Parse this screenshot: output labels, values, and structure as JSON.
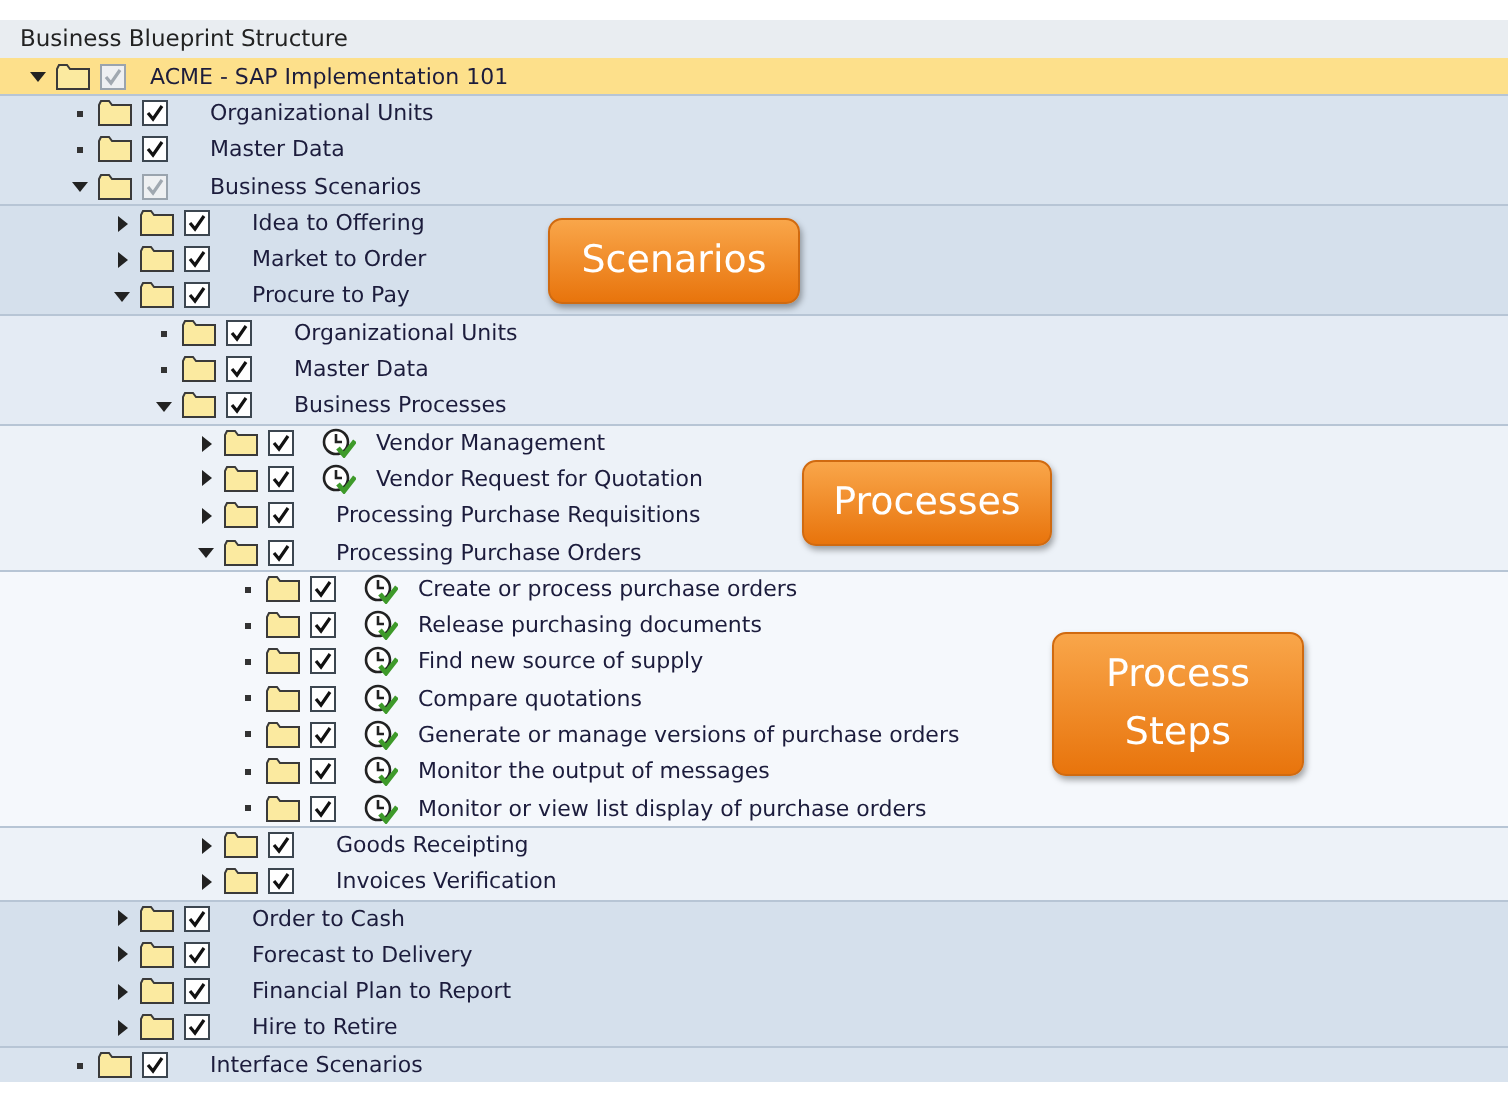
{
  "header": {
    "title": "Business Blueprint Structure"
  },
  "tree": [
    {
      "label": "ACME - SAP Implementation 101",
      "kind": "branch",
      "expanded": true,
      "selected": true,
      "checked": true,
      "disabled": true,
      "process_icon": false,
      "children": [
        {
          "label": "Organizational Units",
          "kind": "leaf",
          "selected": false,
          "checked": true,
          "disabled": false,
          "process_icon": false
        },
        {
          "label": "Master Data",
          "kind": "leaf",
          "selected": false,
          "checked": true,
          "disabled": false,
          "process_icon": false
        },
        {
          "label": "Business Scenarios",
          "kind": "branch",
          "expanded": true,
          "selected": false,
          "checked": true,
          "disabled": true,
          "process_icon": false,
          "children": [
            {
              "label": "Idea to Offering",
              "kind": "branch",
              "expanded": false,
              "selected": false,
              "checked": true,
              "disabled": false,
              "process_icon": false
            },
            {
              "label": "Market to Order",
              "kind": "branch",
              "expanded": false,
              "selected": false,
              "checked": true,
              "disabled": false,
              "process_icon": false
            },
            {
              "label": "Procure to Pay",
              "kind": "branch",
              "expanded": true,
              "selected": false,
              "checked": true,
              "disabled": false,
              "process_icon": false,
              "children": [
                {
                  "label": "Organizational Units",
                  "kind": "leaf",
                  "selected": false,
                  "checked": true,
                  "disabled": false,
                  "process_icon": false
                },
                {
                  "label": "Master Data",
                  "kind": "leaf",
                  "selected": false,
                  "checked": true,
                  "disabled": false,
                  "process_icon": false
                },
                {
                  "label": "Business Processes",
                  "kind": "branch",
                  "expanded": true,
                  "selected": false,
                  "checked": true,
                  "disabled": false,
                  "process_icon": false,
                  "children": [
                    {
                      "label": "Vendor Management",
                      "kind": "branch",
                      "expanded": false,
                      "selected": false,
                      "checked": true,
                      "disabled": false,
                      "process_icon": true
                    },
                    {
                      "label": "Vendor Request for Quotation",
                      "kind": "branch",
                      "expanded": false,
                      "selected": false,
                      "checked": true,
                      "disabled": false,
                      "process_icon": true
                    },
                    {
                      "label": "Processing Purchase Requisitions",
                      "kind": "branch",
                      "expanded": false,
                      "selected": false,
                      "checked": true,
                      "disabled": false,
                      "process_icon": false
                    },
                    {
                      "label": "Processing Purchase Orders",
                      "kind": "branch",
                      "expanded": true,
                      "selected": false,
                      "checked": true,
                      "disabled": false,
                      "process_icon": false,
                      "children": [
                        {
                          "label": "Create or process purchase orders",
                          "kind": "leaf",
                          "selected": false,
                          "checked": true,
                          "disabled": false,
                          "process_icon": true
                        },
                        {
                          "label": "Release purchasing documents",
                          "kind": "leaf",
                          "selected": false,
                          "checked": true,
                          "disabled": false,
                          "process_icon": true
                        },
                        {
                          "label": "Find new source of supply",
                          "kind": "leaf",
                          "selected": false,
                          "checked": true,
                          "disabled": false,
                          "process_icon": true
                        },
                        {
                          "label": "Compare quotations",
                          "kind": "leaf",
                          "selected": false,
                          "checked": true,
                          "disabled": false,
                          "process_icon": true
                        },
                        {
                          "label": "Generate or manage versions of purchase orders",
                          "kind": "leaf",
                          "selected": false,
                          "checked": true,
                          "disabled": false,
                          "process_icon": true
                        },
                        {
                          "label": "Monitor the output of messages",
                          "kind": "leaf",
                          "selected": false,
                          "checked": true,
                          "disabled": false,
                          "process_icon": true
                        },
                        {
                          "label": "Monitor or view list display of purchase orders",
                          "kind": "leaf",
                          "selected": false,
                          "checked": true,
                          "disabled": false,
                          "process_icon": true
                        }
                      ]
                    },
                    {
                      "label": "Goods Receipting",
                      "kind": "branch",
                      "expanded": false,
                      "selected": false,
                      "checked": true,
                      "disabled": false,
                      "process_icon": false
                    },
                    {
                      "label": "Invoices Verification",
                      "kind": "branch",
                      "expanded": false,
                      "selected": false,
                      "checked": true,
                      "disabled": false,
                      "process_icon": false
                    }
                  ]
                }
              ]
            },
            {
              "label": "Order to Cash",
              "kind": "branch",
              "expanded": false,
              "selected": false,
              "checked": true,
              "disabled": false,
              "process_icon": false
            },
            {
              "label": "Forecast to Delivery",
              "kind": "branch",
              "expanded": false,
              "selected": false,
              "checked": true,
              "disabled": false,
              "process_icon": false
            },
            {
              "label": "Financial Plan to Report",
              "kind": "branch",
              "expanded": false,
              "selected": false,
              "checked": true,
              "disabled": false,
              "process_icon": false
            },
            {
              "label": "Hire to Retire",
              "kind": "branch",
              "expanded": false,
              "selected": false,
              "checked": true,
              "disabled": false,
              "process_icon": false
            }
          ]
        },
        {
          "label": "Interface Scenarios",
          "kind": "leaf",
          "selected": false,
          "checked": true,
          "disabled": false,
          "process_icon": false
        }
      ]
    }
  ],
  "callouts": [
    {
      "text": "Scenarios"
    },
    {
      "text": "Processes"
    },
    {
      "text": "Process Steps"
    }
  ]
}
